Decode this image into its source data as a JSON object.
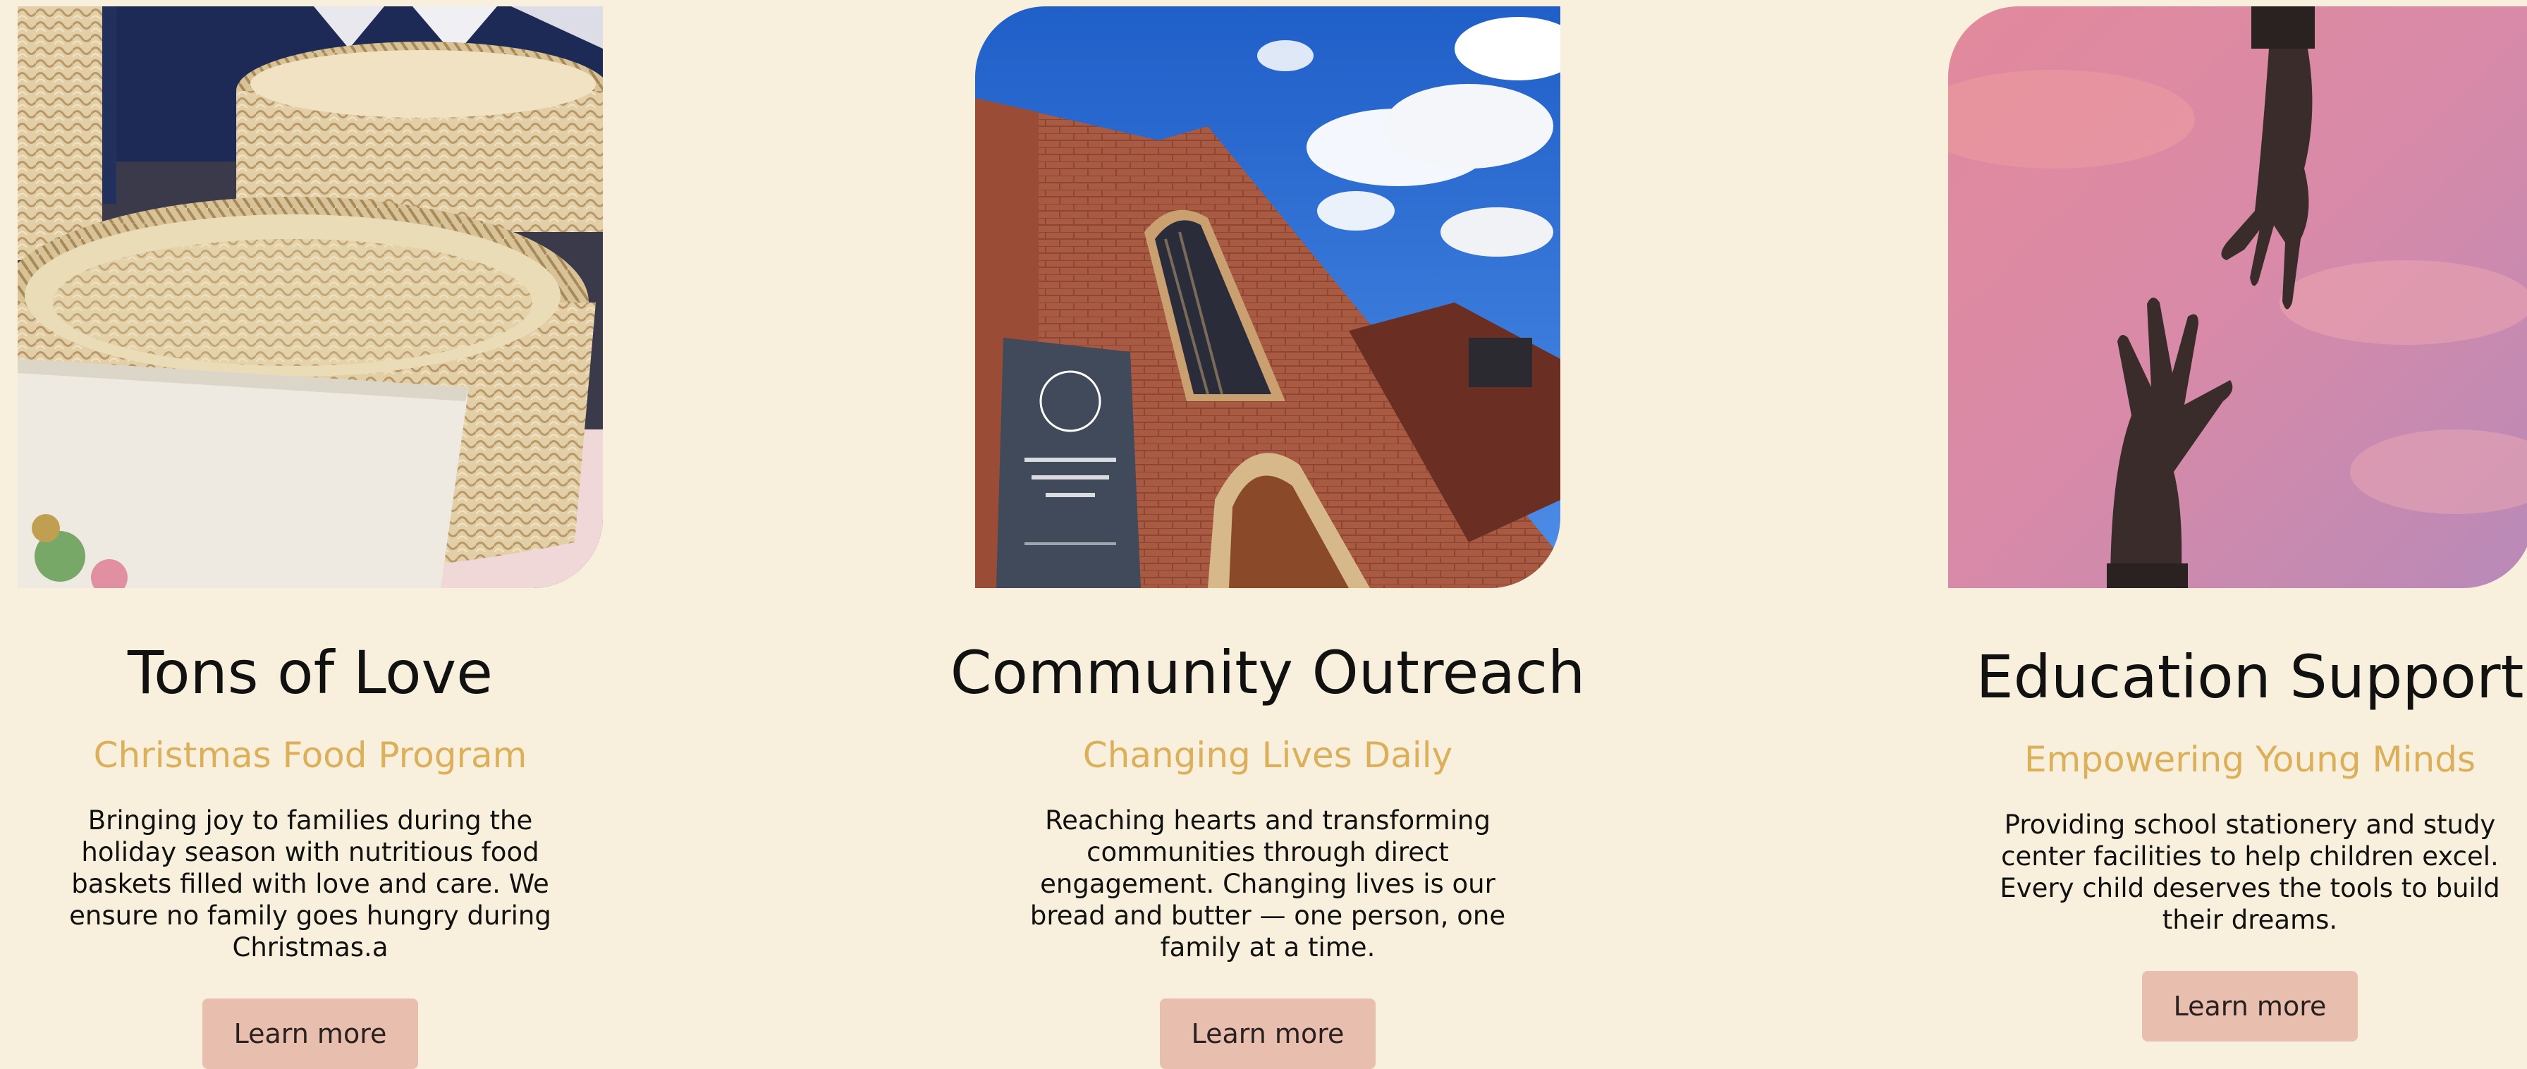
{
  "cards": [
    {
      "image": "woven-baskets-photo",
      "title": "Tons of Love",
      "subtitle": "Christmas Food Program",
      "description": "Bringing joy to families during the holiday season with nutritious food baskets filled with love and care. We ensure no family goes hungry during Christmas.a",
      "button": "Learn more"
    },
    {
      "image": "church-photo",
      "title": "Community Outreach",
      "subtitle": "Changing Lives Daily",
      "description": "Reaching hearts and transforming communities through direct engagement. Changing lives is our bread and butter — one person, one family at a time.",
      "button": "Learn more"
    },
    {
      "image": "reaching-hands-photo",
      "title": "Education Support",
      "subtitle": "Empowering Young Minds",
      "description": "Providing school stationery and study center facilities to help children excel. Every child deserves the tools to build their dreams.",
      "button": "Learn more"
    }
  ],
  "colors": {
    "background": "#f8f0dc",
    "accent": "#dcb05a",
    "button": "#e8bfae"
  }
}
